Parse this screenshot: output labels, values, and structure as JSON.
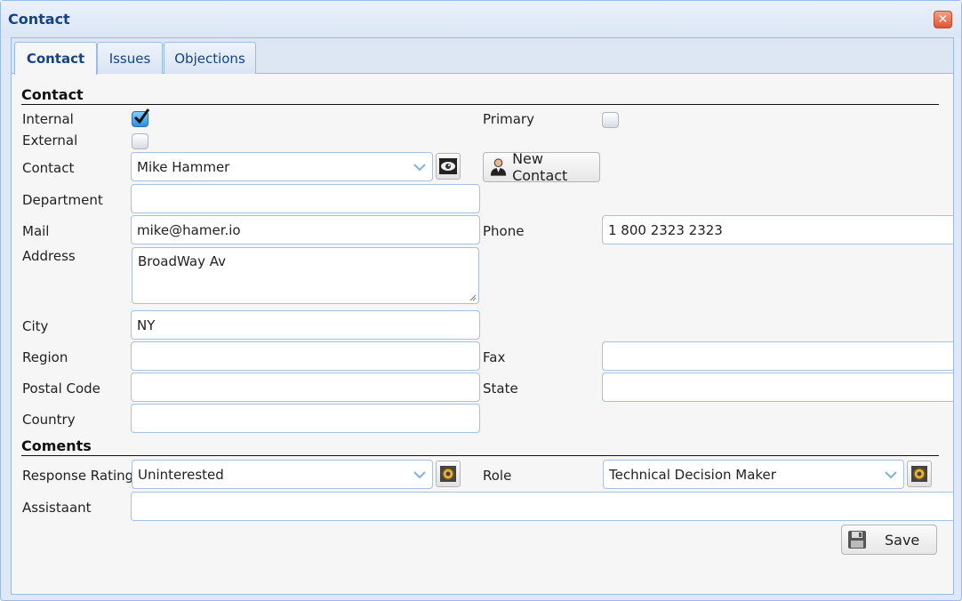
{
  "window": {
    "title": "Contact"
  },
  "tabs": [
    {
      "label": "Contact",
      "active": true
    },
    {
      "label": "Issues",
      "active": false
    },
    {
      "label": "Objections",
      "active": false
    }
  ],
  "contact_section": {
    "title": "Contact",
    "internal_label": "Internal",
    "internal_checked": true,
    "external_label": "External",
    "external_checked": false,
    "primary_label": "Primary",
    "primary_checked": false,
    "contact_label": "Contact",
    "contact_value": "Mike Hammer",
    "new_contact_label": "New Contact",
    "department_label": "Department",
    "department_value": "",
    "mail_label": "Mail",
    "mail_value": "mike@hamer.io",
    "phone_label": "Phone",
    "phone_value": "1 800 2323 2323",
    "address_label": "Address",
    "address_value": "BroadWay Av",
    "city_label": "City",
    "city_value": "NY",
    "region_label": "Region",
    "region_value": "",
    "fax_label": "Fax",
    "fax_value": "",
    "postal_label": "Postal Code",
    "postal_value": "",
    "state_label": "State",
    "state_value": "",
    "country_label": "Country",
    "country_value": ""
  },
  "comments_section": {
    "title": "Coments",
    "response_label": "Response Rating",
    "response_value": "Uninterested",
    "role_label": "Role",
    "role_value": "Technical Decision Maker",
    "assistant_label": "Assistaant",
    "assistant_value": ""
  },
  "actions": {
    "save_label": "Save"
  },
  "colors": {
    "accent": "#15428b",
    "border": "#99bbe8",
    "close": "#e0532f"
  }
}
